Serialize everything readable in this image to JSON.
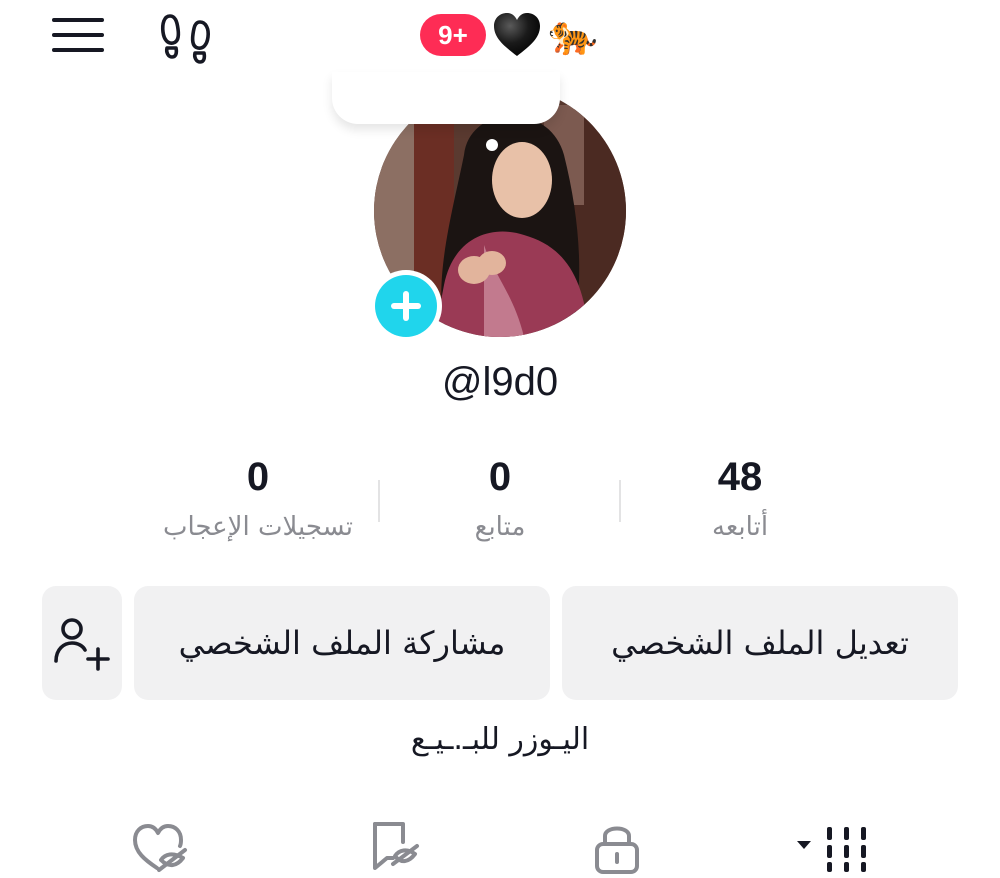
{
  "header": {
    "notification_count": "9+",
    "heart_emoji": "🖤",
    "tiger_emoji": "🐅",
    "badge_color": "#fe2c55"
  },
  "profile": {
    "username": "@l9d0",
    "bio": "اليـوزر للبـ.ـيـع",
    "accent_color": "#20d5ec"
  },
  "stats": {
    "following": {
      "value": "48",
      "label": "أتابعه"
    },
    "followers": {
      "value": "0",
      "label": "متابع"
    },
    "likes": {
      "value": "0",
      "label": "تسجيلات الإعجاب"
    }
  },
  "actions": {
    "edit_profile": "تعديل الملف الشخصي",
    "share_profile": "مشاركة الملف الشخصي"
  },
  "tabs": [
    {
      "name": "videos",
      "icon": "grid-icon",
      "selected": true
    },
    {
      "name": "private",
      "icon": "lock-icon"
    },
    {
      "name": "reposts",
      "icon": "repost-icon"
    },
    {
      "name": "liked",
      "icon": "liked-hidden-icon"
    }
  ]
}
